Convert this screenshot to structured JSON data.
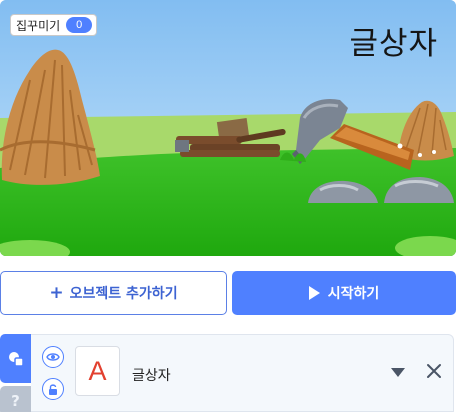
{
  "stage": {
    "variable": {
      "name": "집꾸미기",
      "value": "0"
    },
    "text_object": "글상자"
  },
  "buttons": {
    "add_object": "오브젝트 추가하기",
    "start": "시작하기"
  },
  "object_panel": {
    "help_tab": "?",
    "object": {
      "thumbnail_letter": "A",
      "name": "글상자"
    }
  },
  "colors": {
    "accent": "#4f80ff",
    "sky": "#8fc6f4",
    "grass": "#22b111",
    "thumbnail_letter": "#e2402f"
  }
}
